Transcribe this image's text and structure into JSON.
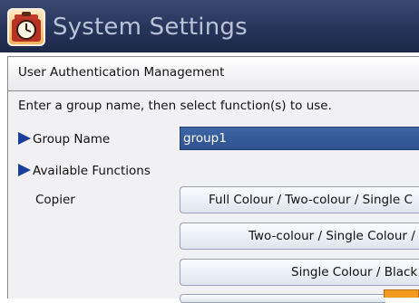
{
  "window": {
    "title": "System Settings",
    "icon": "clock-toolbox-icon"
  },
  "panel": {
    "title": "User Authentication Management",
    "instruction": "Enter a group name, then select function(s) to use."
  },
  "group_name": {
    "label": "Group Name",
    "value": "group1"
  },
  "available_functions": {
    "label": "Available Functions",
    "copier_label": "Copier",
    "buttons": [
      "Full Colour / Two-colour / Single C",
      "Two-colour / Single Colour /",
      "Single Colour / Black"
    ]
  },
  "colors": {
    "titlebar": "#27345a",
    "field_selected": "#3e66a4",
    "triangle": "#1b3f9a",
    "accent_orange": "#f29a1e"
  }
}
